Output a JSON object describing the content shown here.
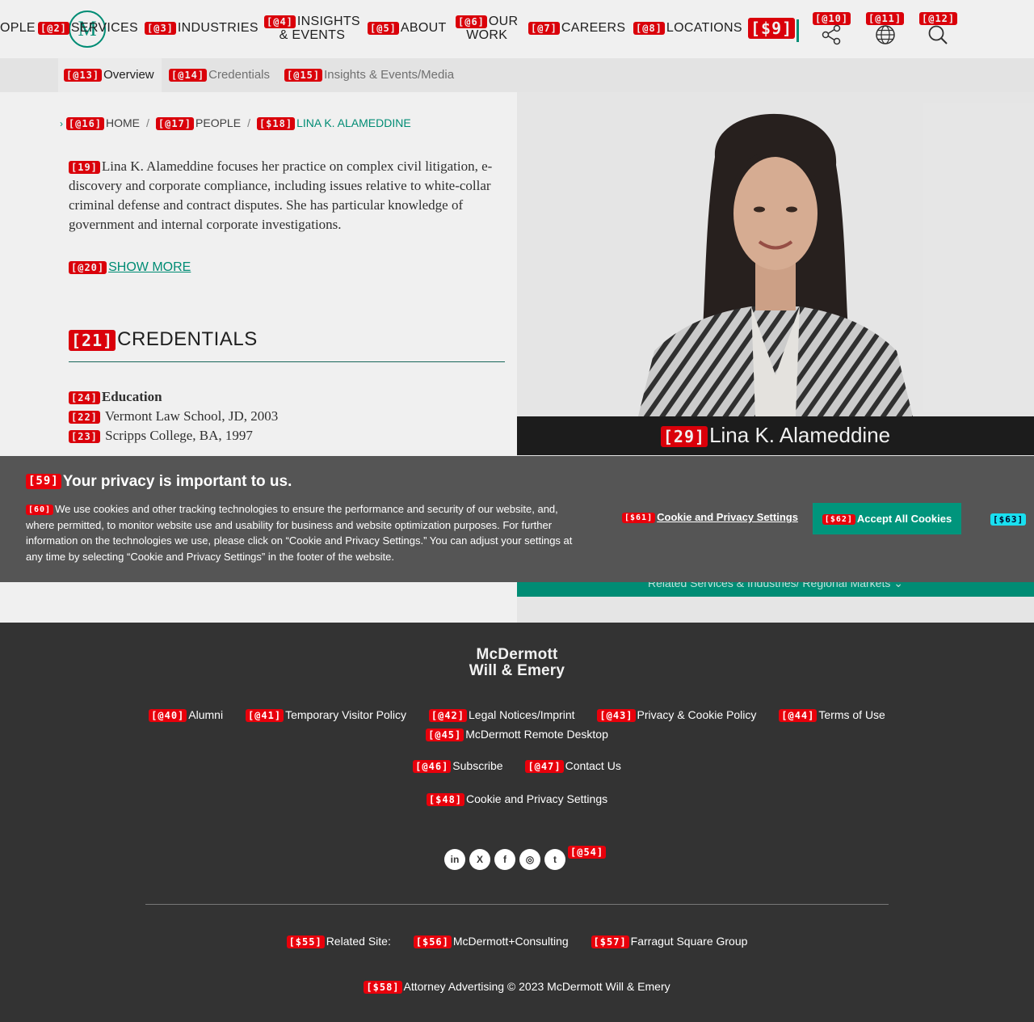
{
  "nav": {
    "items": [
      {
        "tag": "",
        "label": "OPLE"
      },
      {
        "tag": "[@2]",
        "label": "SERVICES"
      },
      {
        "tag": "[@3]",
        "label": "INDUSTRIES"
      },
      {
        "tag": "[@4]",
        "label": "INSIGHTS",
        "label2": "& EVENTS"
      },
      {
        "tag": "[@5]",
        "label": "ABOUT"
      },
      {
        "tag": "[@6]",
        "label": "OUR",
        "label2": "WORK"
      },
      {
        "tag": "[@7]",
        "label": "CAREERS"
      },
      {
        "tag": "[@8]",
        "label": "LOCATIONS"
      }
    ],
    "search_tag": "[$9]",
    "share_tag": "[@10]",
    "globe_tag": "[@11]",
    "search_icon_tag": "[@12]",
    "logo_letter": "M",
    "accent": "#00957c"
  },
  "subnav": {
    "tabs": [
      {
        "tag": "[@13]",
        "label": "Overview"
      },
      {
        "tag": "[@14]",
        "label": "Credentials"
      },
      {
        "tag": "[@15]",
        "label": "Insights & Events/Media"
      }
    ]
  },
  "breadcrumb": [
    {
      "tag": "[@16]",
      "label": "HOME"
    },
    {
      "tag": "[@17]",
      "label": "PEOPLE"
    },
    {
      "tag": "[$18]",
      "label": "LINA K. ALAMEDDINE"
    }
  ],
  "summary": {
    "tag": "[19]",
    "text": "Lina K. Alameddine focuses her practice on complex civil litigation, e-discovery and corporate compliance, including issues relative to white-collar criminal defense and contract disputes. She has particular knowledge of government and internal corporate investigations."
  },
  "show_more": {
    "tag": "[@20]",
    "label": "SHOW MORE"
  },
  "credentials": {
    "tag": "[21]",
    "title": "CREDENTIALS",
    "education": {
      "tag": "[24]",
      "label": "Education"
    },
    "items": [
      {
        "tag": "[22]",
        "text": "Vermont Law School, JD, 2003"
      },
      {
        "tag": "[23]",
        "text": "Scripps College, BA, 1997"
      }
    ]
  },
  "profile": {
    "tag": "[29]",
    "name": "Lina K. Alameddine"
  },
  "related": {
    "label": "Related Services & Industries/ Regional Markets"
  },
  "cookie": {
    "title_tag": "[59]",
    "title": "Your privacy is important to us.",
    "text_tag": "[60]",
    "text": "We use cookies and other tracking technologies to ensure the performance and security of our website, and, where permitted, to monitor website use and usability for business and website optimization purposes. For further information on the technologies we use, please click on “Cookie and Privacy Settings.” You can adjust your settings at any time by selecting “Cookie and Privacy Settings” in the footer of the website.",
    "settings_tag": "[$61]",
    "settings_label": "Cookie and Privacy Settings",
    "accept_tag": "[$62]",
    "accept_label": "Accept All Cookies",
    "close_tag": "[$63]"
  },
  "footer": {
    "logo_line1": "McDermott",
    "logo_line2": "Will & Emery",
    "row1": [
      {
        "tag": "[@40]",
        "label": "Alumni"
      },
      {
        "tag": "[@41]",
        "label": "Temporary Visitor Policy"
      },
      {
        "tag": "[@42]",
        "label": "Legal Notices/Imprint"
      },
      {
        "tag": "[@43]",
        "label": "Privacy & Cookie Policy"
      },
      {
        "tag": "[@44]",
        "label": "Terms of Use"
      }
    ],
    "row2": [
      {
        "tag": "[@45]",
        "label": "McDermott Remote Desktop"
      }
    ],
    "row3": [
      {
        "tag": "[@46]",
        "label": "Subscribe"
      },
      {
        "tag": "[@47]",
        "label": "Contact Us"
      }
    ],
    "row4": [
      {
        "tag": "[$48]",
        "label": "Cookie and Privacy Settings"
      }
    ],
    "social": [
      "linkedin-icon",
      "xing-icon",
      "facebook-icon",
      "instagram-icon",
      "twitter-icon"
    ],
    "social_tag": "[@54]",
    "related": [
      {
        "tag": "[$55]",
        "label": "Related Site:"
      },
      {
        "tag": "[$56]",
        "label": "McDermott+Consulting"
      },
      {
        "tag": "[$57]",
        "label": "Farragut Square Group"
      }
    ],
    "copyright_tag": "[$58]",
    "copyright": "Attorney Advertising © 2023 McDermott Will & Emery"
  }
}
